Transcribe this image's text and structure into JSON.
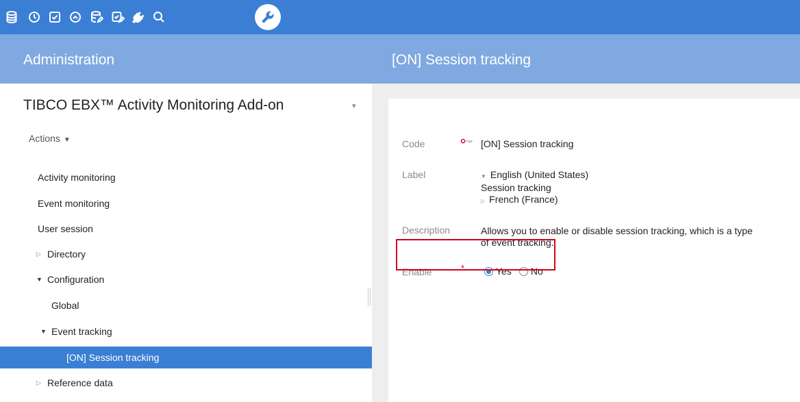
{
  "toolbar": {
    "icons": [
      "database-icon",
      "clock-icon",
      "checkbox-icon",
      "dashboard-icon",
      "database-edit-icon",
      "checklist-edit-icon",
      "plug-icon",
      "search-icon",
      "wrench-icon"
    ],
    "accent": "#3b7fd4"
  },
  "header": {
    "left_title": "Administration",
    "right_title": "[ON] Session tracking"
  },
  "sidebar": {
    "app_title": "TIBCO EBX™ Activity Monitoring Add-on",
    "actions_label": "Actions",
    "items": [
      {
        "label": "Activity monitoring"
      },
      {
        "label": "Event monitoring"
      },
      {
        "label": "User session"
      },
      {
        "label": "Directory"
      },
      {
        "label": "Configuration"
      },
      {
        "label": "Global"
      },
      {
        "label": "Event tracking"
      },
      {
        "label": "[ON] Session tracking"
      },
      {
        "label": "Reference data"
      }
    ]
  },
  "form": {
    "code": {
      "label": "Code",
      "value": "[ON] Session tracking"
    },
    "label_field": {
      "label": "Label",
      "languages": [
        {
          "name": "English (United States)",
          "value": "Session tracking",
          "expanded": true
        },
        {
          "name": "French (France)",
          "expanded": false
        }
      ]
    },
    "description": {
      "label": "Description",
      "line1": "Allows you to enable or disable session tracking, which is a type",
      "line2": "of event tracking."
    },
    "enable": {
      "label": "Enable",
      "required_mark": "*",
      "options": [
        "Yes",
        "No"
      ],
      "selected": "Yes"
    }
  }
}
